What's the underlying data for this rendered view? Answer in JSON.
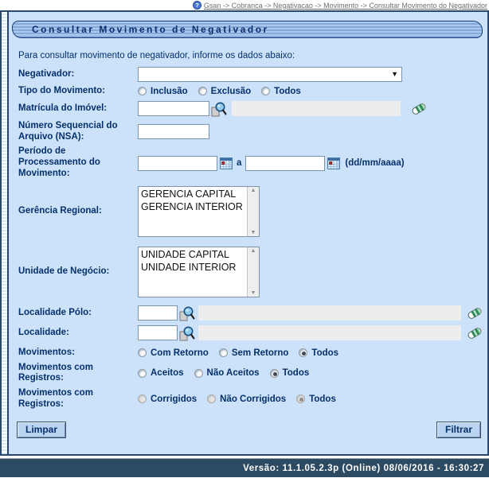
{
  "breadcrumb": {
    "path": "Gsan -> Cobranca -> Negativacao -> Movimento -> Consultar Movimento do Negativador",
    "help_icon": "help-icon"
  },
  "title": "Consultar Movimento de Negativador",
  "intro": "Para consultar movimento de negativador, informe os dados abaixo:",
  "fields": {
    "negativador": {
      "label": "Negativador:",
      "value": "",
      "dropdown_icon": "chevron-down-icon"
    },
    "tipo_movimento": {
      "label": "Tipo do Movimento:",
      "options": [
        "Inclusão",
        "Exclusão",
        "Todos"
      ],
      "selected": ""
    },
    "matricula": {
      "label": "Matrícula do Imóvel:",
      "value": "",
      "description": "",
      "icons": [
        "search-icon",
        "eraser-icon"
      ]
    },
    "nsa": {
      "label": "Número Sequencial do Arquivo (NSA):",
      "value": ""
    },
    "periodo": {
      "label": "Período de Processamento do Movimento:",
      "from": "",
      "to": "",
      "separator": "a",
      "hint": "(dd/mm/aaaa)",
      "icons": [
        "calendar-icon",
        "calendar-icon"
      ]
    },
    "gerencia_regional": {
      "label": "Gerência Regional:",
      "options": [
        "GERENCIA CAPITAL",
        "GERENCIA INTERIOR"
      ]
    },
    "unidade_negocio": {
      "label": "Unidade de Negócio:",
      "options": [
        "UNIDADE CAPITAL",
        "UNIDADE INTERIOR"
      ]
    },
    "localidade_polo": {
      "label": "Localidade Pólo:",
      "value": "",
      "description": "",
      "icons": [
        "search-icon",
        "eraser-icon"
      ]
    },
    "localidade": {
      "label": "Localidade:",
      "value": "",
      "description": "",
      "icons": [
        "search-icon",
        "eraser-icon"
      ]
    },
    "movimentos": {
      "label": "Movimentos:",
      "options": [
        "Com Retorno",
        "Sem Retorno",
        "Todos"
      ],
      "selected": "Todos"
    },
    "mov_registros_1": {
      "label": "Movimentos com Registros:",
      "options": [
        "Aceitos",
        "Não Aceitos",
        "Todos"
      ],
      "selected": "Todos"
    },
    "mov_registros_2": {
      "label": "Movimentos com Registros:",
      "options": [
        "Corrigidos",
        "Não Corrigidos",
        "Todos"
      ],
      "selected": "Todos",
      "disabled": true
    }
  },
  "buttons": {
    "limpar": "Limpar",
    "filtrar": "Filtrar"
  },
  "footer": {
    "version": "Versão: 11.1.05.2.3p (Online) 08/06/2016 - 16:30:27"
  },
  "colors": {
    "content_bg": "#cbe2fa",
    "footer_bg": "#2d4a63",
    "label_text": "#05306b",
    "readonly_bg": "#ededed",
    "button_bg": "#b9d3f0"
  }
}
